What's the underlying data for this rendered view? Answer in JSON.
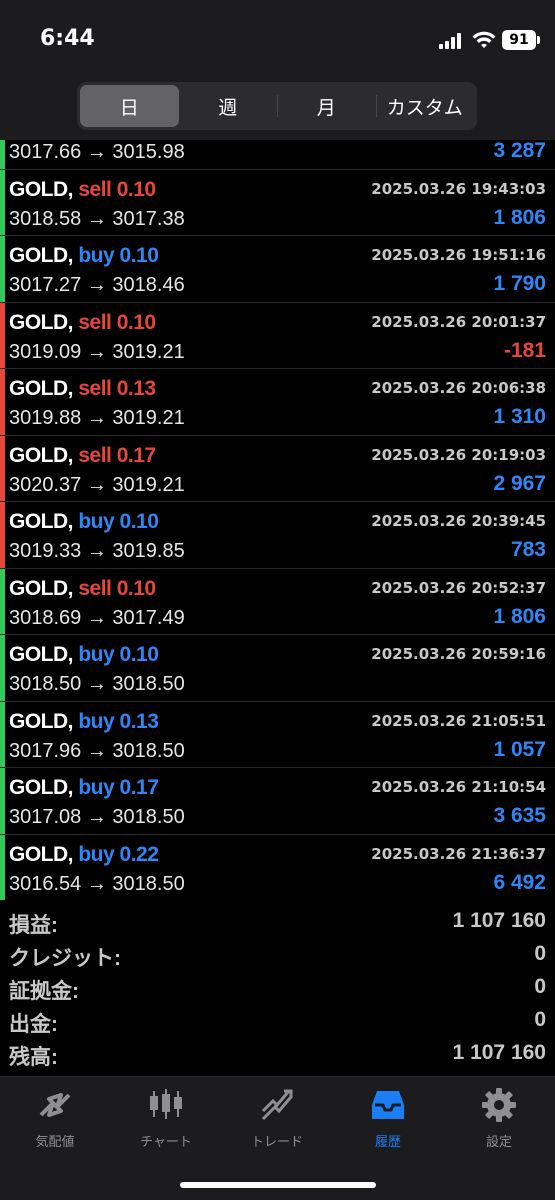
{
  "status": {
    "time": "6:44",
    "battery": "91"
  },
  "periods": [
    "日",
    "週",
    "月",
    "カスタム"
  ],
  "active_period": 0,
  "colors": {
    "sell": "#e8453c",
    "buy": "#2f86f6",
    "profit_pos": "#2f86f6",
    "profit_neg": "#e8453c",
    "bar_green": "#34c759",
    "bar_red": "#e8453c"
  },
  "deals": [
    {
      "symbol": "",
      "side": "",
      "volume": "",
      "time": "",
      "prices": "3017.66 → 3015.98",
      "profit": "3 287",
      "bar": "green"
    },
    {
      "symbol": "GOLD,",
      "side": "sell",
      "volume": "0.10",
      "time": "2025.03.26 19:43:03",
      "prices": "3018.58 → 3017.38",
      "profit": "1 806",
      "bar": "green"
    },
    {
      "symbol": "GOLD,",
      "side": "buy",
      "volume": "0.10",
      "time": "2025.03.26 19:51:16",
      "prices": "3017.27 → 3018.46",
      "profit": "1 790",
      "bar": "green"
    },
    {
      "symbol": "GOLD,",
      "side": "sell",
      "volume": "0.10",
      "time": "2025.03.26 20:01:37",
      "prices": "3019.09 → 3019.21",
      "profit": "-181",
      "bar": "red"
    },
    {
      "symbol": "GOLD,",
      "side": "sell",
      "volume": "0.13",
      "time": "2025.03.26 20:06:38",
      "prices": "3019.88 → 3019.21",
      "profit": "1 310",
      "bar": "red"
    },
    {
      "symbol": "GOLD,",
      "side": "sell",
      "volume": "0.17",
      "time": "2025.03.26 20:19:03",
      "prices": "3020.37 → 3019.21",
      "profit": "2 967",
      "bar": "red"
    },
    {
      "symbol": "GOLD,",
      "side": "buy",
      "volume": "0.10",
      "time": "2025.03.26 20:39:45",
      "prices": "3019.33 → 3019.85",
      "profit": "783",
      "bar": "red"
    },
    {
      "symbol": "GOLD,",
      "side": "sell",
      "volume": "0.10",
      "time": "2025.03.26 20:52:37",
      "prices": "3018.69 → 3017.49",
      "profit": "1 806",
      "bar": "green"
    },
    {
      "symbol": "GOLD,",
      "side": "buy",
      "volume": "0.10",
      "time": "2025.03.26 20:59:16",
      "prices": "3018.50 → 3018.50",
      "profit": "",
      "bar": "green"
    },
    {
      "symbol": "GOLD,",
      "side": "buy",
      "volume": "0.13",
      "time": "2025.03.26 21:05:51",
      "prices": "3017.96 → 3018.50",
      "profit": "1 057",
      "bar": "green"
    },
    {
      "symbol": "GOLD,",
      "side": "buy",
      "volume": "0.17",
      "time": "2025.03.26 21:10:54",
      "prices": "3017.08 → 3018.50",
      "profit": "3 635",
      "bar": "green"
    },
    {
      "symbol": "GOLD,",
      "side": "buy",
      "volume": "0.22",
      "time": "2025.03.26 21:36:37",
      "prices": "3016.54 → 3018.50",
      "profit": "6 492",
      "bar": "green"
    }
  ],
  "summary": [
    {
      "label": "損益:",
      "value": "1 107 160"
    },
    {
      "label": "クレジット:",
      "value": "0"
    },
    {
      "label": "証拠金:",
      "value": "0"
    },
    {
      "label": "出金:",
      "value": "0"
    },
    {
      "label": "残高:",
      "value": "1 107 160"
    }
  ],
  "tabs": [
    {
      "label": "気配値",
      "icon": "quotes-icon"
    },
    {
      "label": "チャート",
      "icon": "chart-icon"
    },
    {
      "label": "トレード",
      "icon": "trade-icon"
    },
    {
      "label": "履歴",
      "icon": "history-icon"
    },
    {
      "label": "設定",
      "icon": "settings-icon"
    }
  ],
  "active_tab": 3
}
